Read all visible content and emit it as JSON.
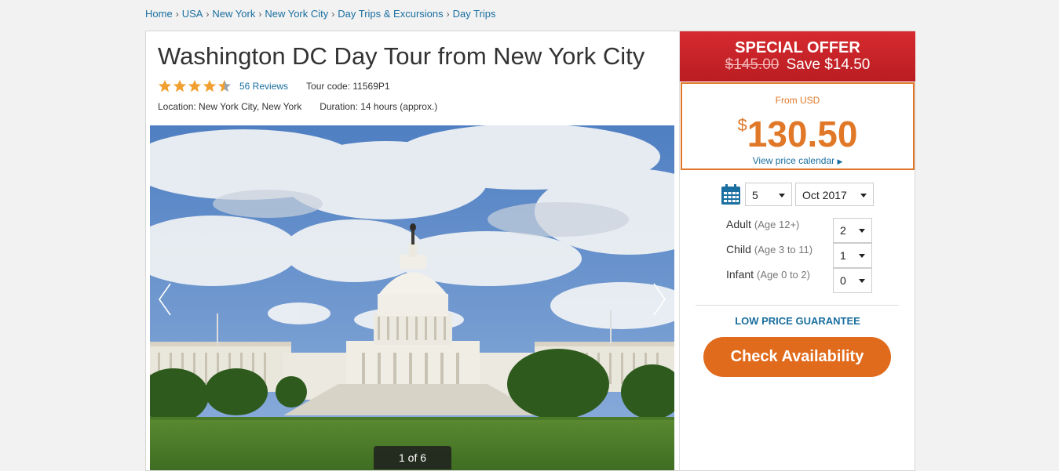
{
  "breadcrumb": [
    "Home",
    "USA",
    "New York",
    "New York City",
    "Day Trips & Excursions",
    "Day Trips"
  ],
  "breadcrumb_separator": "›",
  "tour": {
    "title": "Washington DC Day Tour from New York City",
    "rating": 4.5,
    "reviews": "56 Reviews",
    "tour_code": "Tour code: 11569P1",
    "location": "Location: New York City, New York",
    "duration": "Duration: 14 hours (approx.)"
  },
  "gallery": {
    "counter": "1 of 6"
  },
  "offer": {
    "title": "SPECIAL OFFER",
    "old_price": "$145.00",
    "save": "Save $14.50"
  },
  "price": {
    "from": "From USD",
    "currency": "$",
    "amount": "130.50",
    "calendar_link": "View price calendar",
    "calendar_link_icon": "▶"
  },
  "booking": {
    "day": "5",
    "month": "Oct 2017",
    "adult_label": "Adult",
    "adult_age": "(Age 12+)",
    "adult_count": "2",
    "child_label": "Child",
    "child_age": "(Age 3 to 11)",
    "child_count": "1",
    "infant_label": "Infant",
    "infant_age": "(Age 0 to 2)",
    "infant_count": "0",
    "guarantee": "LOW PRICE GUARANTEE",
    "check_button": "Check Availability"
  },
  "colors": {
    "link": "#1a6fa0",
    "offer_red": "#c8242a",
    "price_orange": "#e07828",
    "button_orange": "#e16b1c",
    "star": "#f0a030"
  }
}
